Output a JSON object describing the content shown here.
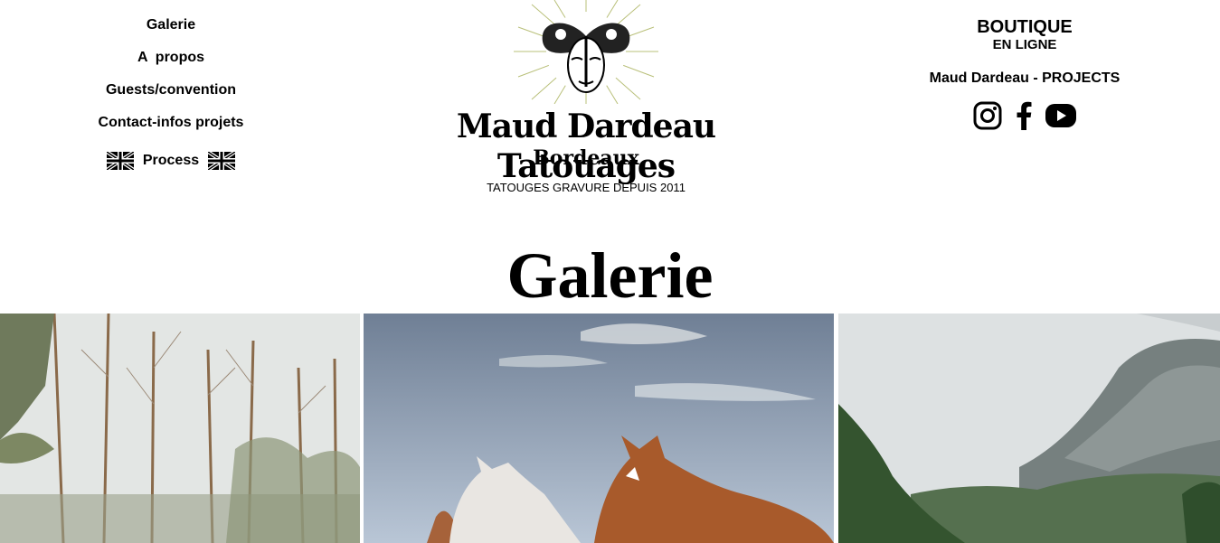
{
  "nav": {
    "galerie": "Galerie",
    "apropos": "A  propos",
    "guests": "Guests/convention",
    "contact": "Contact-infos projets",
    "process": "Process"
  },
  "logo": {
    "name": "Maud Dardeau Tatouages",
    "city": "Bordeaux",
    "tagline": "TATOUGES GRAVURE DEPUIS 2011"
  },
  "shop": {
    "title": "BOUTIQUE",
    "subtitle": "EN LIGNE",
    "projects": "Maud Dardeau - PROJECTS"
  },
  "socials": [
    "instagram-icon",
    "facebook-icon",
    "youtube-icon"
  ],
  "page": {
    "title": "Galerie"
  },
  "gallery": [
    "forest",
    "horses",
    "mountain"
  ],
  "colors": {
    "text": "#000000",
    "background": "#ffffff",
    "emblem_ray": "#b9c07a"
  }
}
